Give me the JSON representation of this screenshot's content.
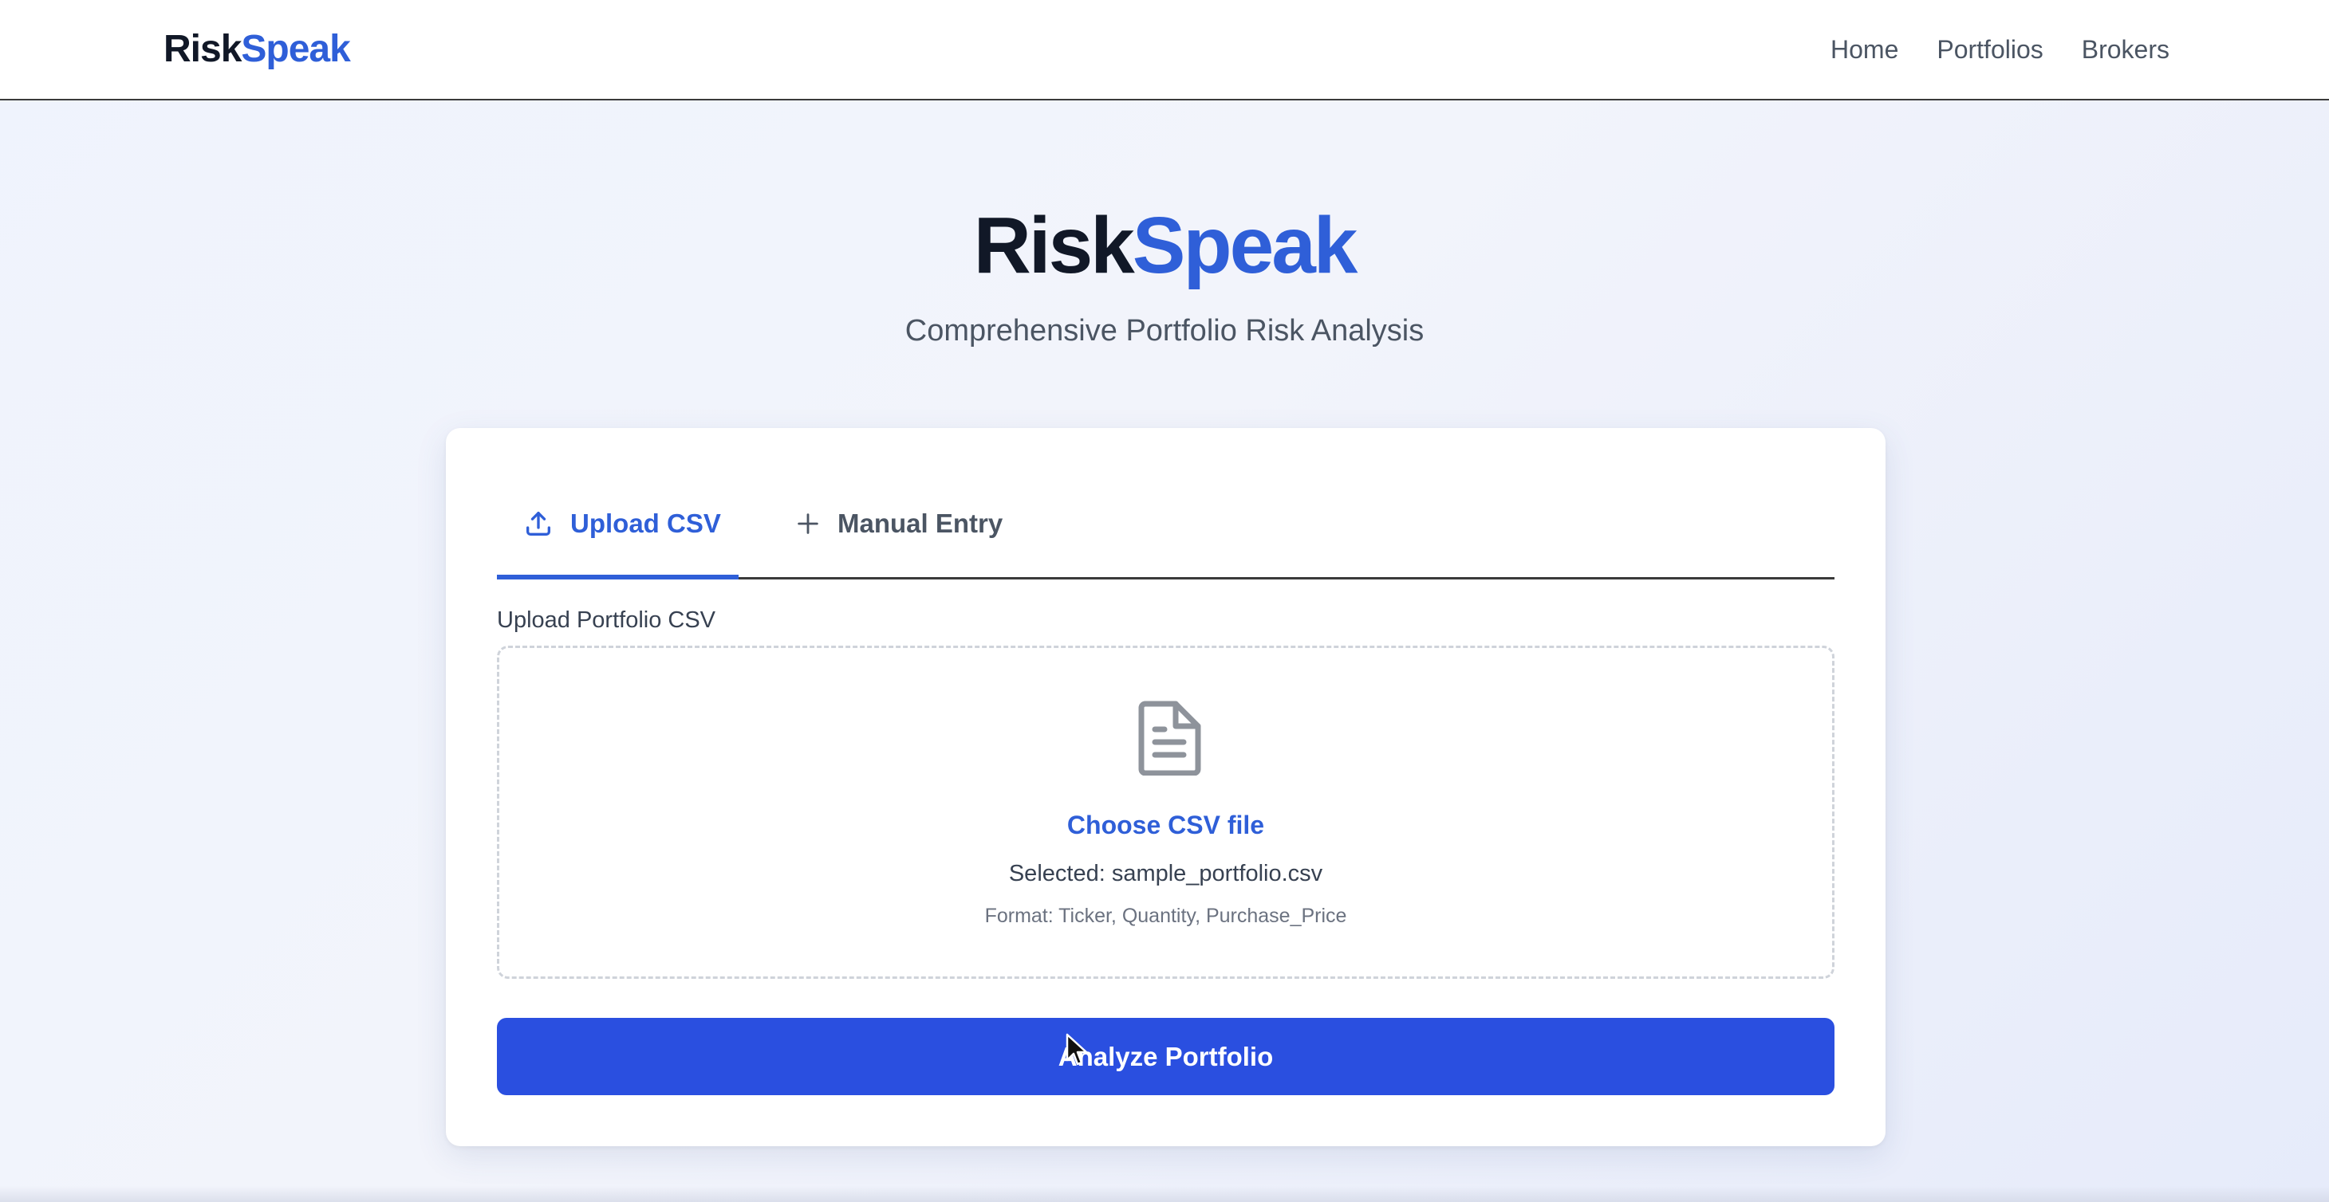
{
  "header": {
    "brand_part1": "Risk",
    "brand_part2": "Speak",
    "nav": [
      "Home",
      "Portfolios",
      "Brokers"
    ]
  },
  "hero": {
    "title_part1": "Risk",
    "title_part2": "Speak",
    "subtitle": "Comprehensive Portfolio Risk Analysis"
  },
  "tabs": {
    "upload_label": "Upload CSV",
    "manual_label": "Manual Entry",
    "active": "upload"
  },
  "upload": {
    "field_label": "Upload Portfolio CSV",
    "choose_label": "Choose CSV file",
    "selected_text": "Selected: sample_portfolio.csv",
    "format_text": "Format: Ticker, Quantity, Purchase_Price"
  },
  "actions": {
    "analyze_label": "Analyze Portfolio"
  },
  "colors": {
    "accent": "#2f5fd8",
    "button": "#2a4fe0"
  },
  "icons": {
    "upload_tab": "upload-icon",
    "manual_tab": "plus-icon",
    "dropzone": "document-icon"
  }
}
